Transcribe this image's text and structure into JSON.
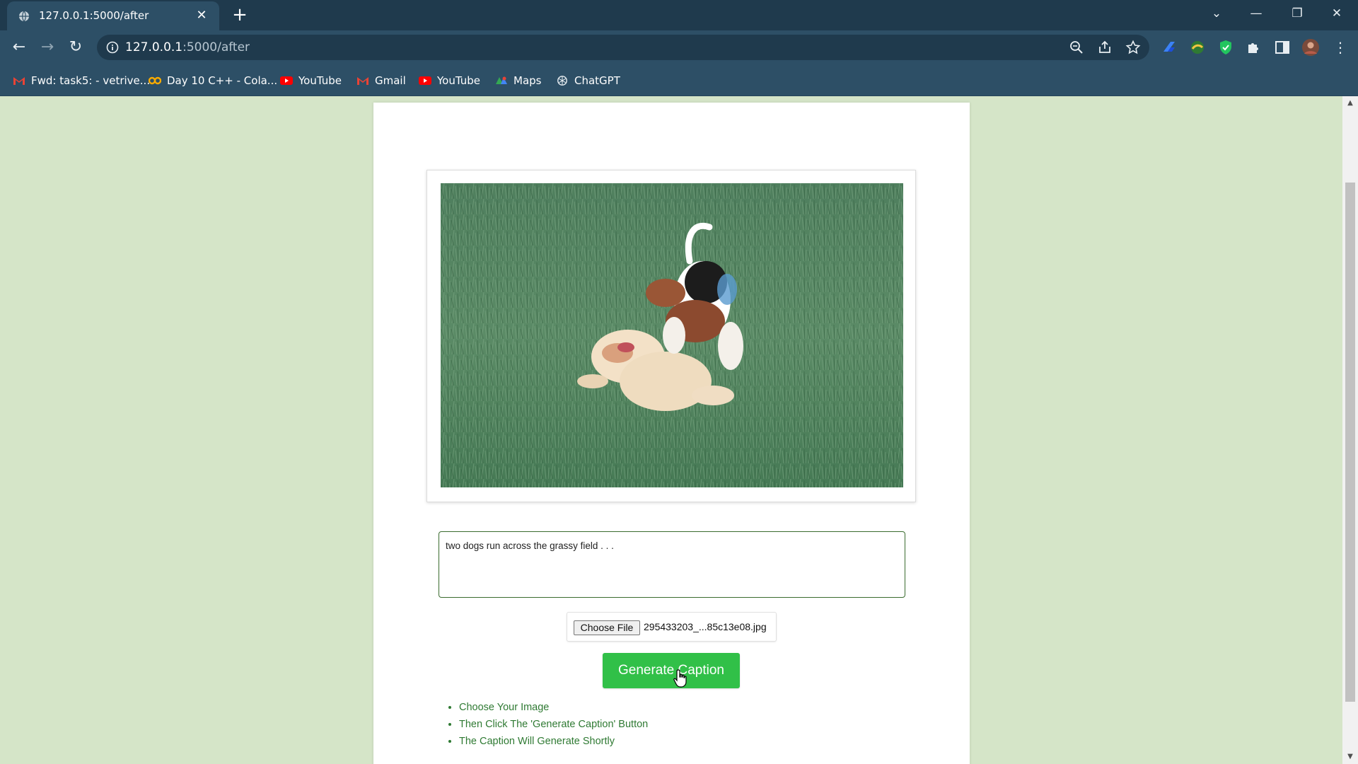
{
  "browser": {
    "tab": {
      "title": "127.0.0.1:5000/after",
      "favicon": "globe-icon",
      "close": "✕"
    },
    "new_tab": "+",
    "window_controls": {
      "dropdown": "⌄",
      "minimize": "—",
      "restore": "❐",
      "close": "✕"
    },
    "nav": {
      "back": "←",
      "forward": "→",
      "reload": "↻"
    },
    "url": {
      "host": "127.0.0.1",
      "rest": ":5000/after"
    },
    "bookmarks": [
      {
        "label": "Fwd: task5: - vetrive...",
        "icon": "gmail-icon"
      },
      {
        "label": "Day 10 C++ - Cola...",
        "icon": "colab-icon"
      },
      {
        "label": "YouTube",
        "icon": "youtube-icon"
      },
      {
        "label": "Gmail",
        "icon": "gmail-icon"
      },
      {
        "label": "YouTube",
        "icon": "youtube-icon"
      },
      {
        "label": "Maps",
        "icon": "maps-icon"
      },
      {
        "label": "ChatGPT",
        "icon": "chatgpt-icon"
      }
    ],
    "colors": {
      "chrome_dark": "#1f3a4d",
      "chrome": "#2d4f66"
    }
  },
  "page": {
    "caption_text": "two dogs run across the grassy field . . .",
    "file_input": {
      "button_label": "Choose File",
      "file_name": "295433203_...85c13e08.jpg"
    },
    "generate_button": "Generate Caption",
    "instructions": [
      "Choose Your Image",
      "Then Click The 'Generate Caption' Button",
      "The Caption Will Generate Shortly"
    ],
    "colors": {
      "background": "#d5e5c8",
      "button": "#31c048",
      "instruction_text": "#2f7a33"
    }
  }
}
